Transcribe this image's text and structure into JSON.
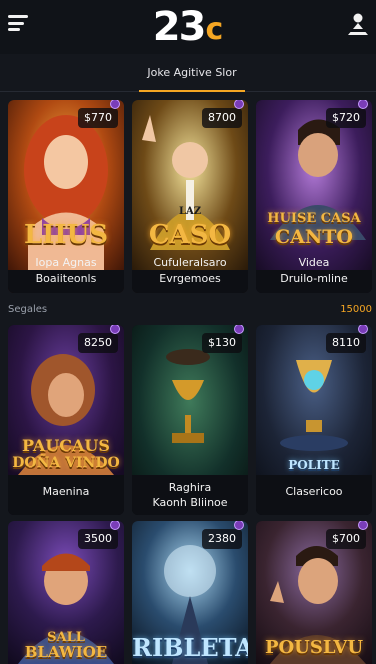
{
  "header": {
    "logo_main": "23",
    "logo_accent": "c",
    "menu_icon": "hamburger-menu-icon",
    "user_icon": "user-profile-icon"
  },
  "tabs": {
    "active_label": "Joke Agitive Slor"
  },
  "colors": {
    "accent": "#f5a623",
    "background": "#14171d"
  },
  "row1": [
    {
      "price": "$770",
      "art_title": "LIIUS",
      "caption_line1": "Iopa Agnas",
      "caption_line2": "Boaiiteonls"
    },
    {
      "price": "8700",
      "art_title": "CASO",
      "art_subtitle": "LAZ",
      "caption_line1": "Cufuleralsaro",
      "caption_line2": "Evrgemoes"
    },
    {
      "price": "$720",
      "art_title_line1": "HUISE CASA",
      "art_title_line2": "CANTO",
      "caption_line1": "Videa",
      "caption_line2": "Druilo-mline"
    }
  ],
  "section": {
    "label": "Segales",
    "more_label": "15000"
  },
  "row2": [
    {
      "price": "8250",
      "art_title_line1": "PAUCAUS",
      "art_title_line2": "DOÑA VINDO",
      "caption_line1": "Maenina"
    },
    {
      "price": "$130",
      "caption_line1": "Raghira",
      "caption_line2": "Kaonh Bliinoe"
    },
    {
      "price": "8110",
      "art_title": "POLITE",
      "caption_line1": "Clasericoo"
    }
  ],
  "row3": [
    {
      "price": "3500",
      "art_title_line1": "SALL",
      "art_title_line2": "BLAWIOE"
    },
    {
      "price": "2380",
      "art_title": "RIBLETA"
    },
    {
      "price": "$700",
      "art_title": "POUSLVU"
    }
  ]
}
